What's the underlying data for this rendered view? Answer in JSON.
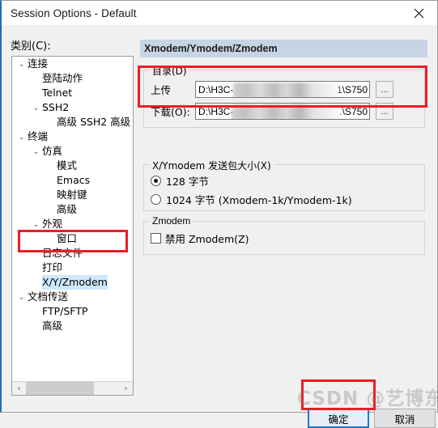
{
  "window": {
    "title": "Session Options - Default",
    "close_icon": "close-icon"
  },
  "category": {
    "label": "类别(C):",
    "tree": [
      {
        "label": "连接",
        "level": 0,
        "chevron": "⌄",
        "selected": false
      },
      {
        "label": "登陆动作",
        "level": 2,
        "chevron": "",
        "selected": false
      },
      {
        "label": "Telnet",
        "level": 2,
        "chevron": "",
        "selected": false
      },
      {
        "label": "SSH2",
        "level": 1,
        "chevron": "⌄",
        "selected": false
      },
      {
        "label": "高级 SSH2 高级",
        "level": 3,
        "chevron": "",
        "selected": false
      },
      {
        "label": "终端",
        "level": 0,
        "chevron": "⌄",
        "selected": false
      },
      {
        "label": "仿真",
        "level": 1,
        "chevron": "⌄",
        "selected": false
      },
      {
        "label": "模式",
        "level": 3,
        "chevron": "",
        "selected": false
      },
      {
        "label": "Emacs",
        "level": 3,
        "chevron": "",
        "selected": false
      },
      {
        "label": "映射键",
        "level": 3,
        "chevron": "",
        "selected": false
      },
      {
        "label": "高级",
        "level": 3,
        "chevron": "",
        "selected": false
      },
      {
        "label": "外观",
        "level": 1,
        "chevron": "⌄",
        "selected": false
      },
      {
        "label": "窗口",
        "level": 3,
        "chevron": "",
        "selected": false
      },
      {
        "label": "日志文件",
        "level": 2,
        "chevron": "",
        "selected": false
      },
      {
        "label": "打印",
        "level": 2,
        "chevron": "",
        "selected": false
      },
      {
        "label": "X/Y/Zmodem",
        "level": 2,
        "chevron": "",
        "selected": true
      },
      {
        "label": "文档传送",
        "level": 0,
        "chevron": "⌄",
        "selected": false
      },
      {
        "label": "FTP/SFTP",
        "level": 2,
        "chevron": "",
        "selected": false
      },
      {
        "label": "高级",
        "level": 2,
        "chevron": "",
        "selected": false
      }
    ],
    "scrollbar": {
      "left_arrow": "‹",
      "right_arrow": "›"
    }
  },
  "panel": {
    "header": "Xmodem/Ymodem/Zmodem",
    "directory": {
      "group_title": "目录(D)",
      "upload": {
        "label": "上传",
        "value_prefix": "D:\\H3C-",
        "value_suffix": "1\\S750",
        "browse_button": "..."
      },
      "download": {
        "label": "下载(O):",
        "value_prefix": "D:\\H3C-",
        "value_suffix": ".\\S750",
        "browse_button": "..."
      }
    },
    "xymodem": {
      "group_title": "X/Ymodem 发送包大小(X)",
      "options": [
        {
          "label": "128 字节",
          "selected": true
        },
        {
          "label": "1024 字节  (Xmodem-1k/Ymodem-1k)",
          "selected": false
        }
      ]
    },
    "zmodem": {
      "group_title": "Zmodem",
      "checkbox": {
        "label": "禁用 Zmodem(Z)",
        "checked": false
      }
    }
  },
  "buttons": {
    "ok": "确定",
    "cancel": "取消"
  },
  "annotations": {
    "accent_red": "#ee1c25",
    "focus_blue": "#1a7ad4",
    "header_blue": "#c6d4e4",
    "selection_blue": "#cde8ff"
  },
  "watermark": "CSDN @艺博东"
}
